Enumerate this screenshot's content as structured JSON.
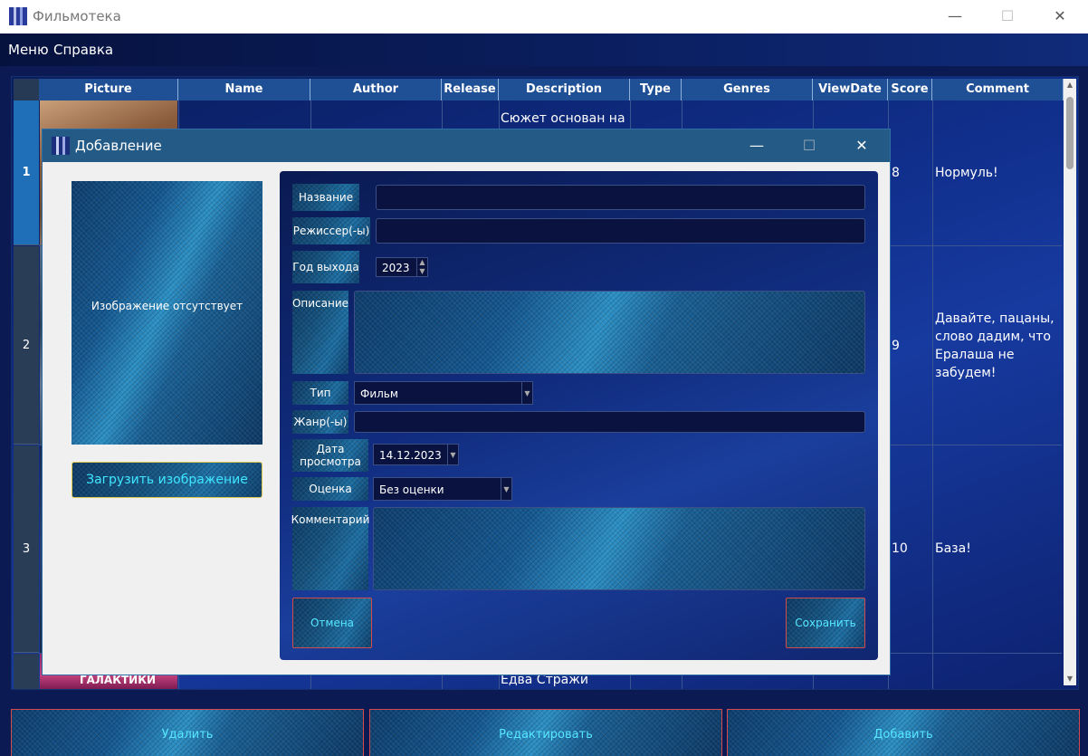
{
  "window": {
    "title": "Фильмотека"
  },
  "menu": [
    "Меню",
    "Справка"
  ],
  "table": {
    "columns": [
      "Picture",
      "Name",
      "Author",
      "Release",
      "Description",
      "Type",
      "Genres",
      "ViewDate",
      "Score",
      "Comment"
    ],
    "rows": [
      {
        "index": "1",
        "description": "Сюжет основан на",
        "score": "8",
        "comment": "Нормуль!"
      },
      {
        "index": "2",
        "description": "",
        "score": "9",
        "comment": "Давайте, пацаны, слово дадим, что Ералаша не забудем!"
      },
      {
        "index": "3",
        "description": "",
        "score": "10",
        "comment": "База!"
      },
      {
        "index": "",
        "description": "Едва Стражи",
        "score": "",
        "comment": ""
      }
    ],
    "poster_caption": "ГАЛАКТИКИ"
  },
  "bottom_buttons": {
    "delete": "Удалить",
    "edit": "Редактировать",
    "add": "Добавить"
  },
  "dialog": {
    "title": "Добавление",
    "image_placeholder": "Изображение отсутствует",
    "load_image_button": "Загрузить изображение",
    "fields": {
      "name_label": "Название",
      "name_value": "",
      "director_label": "Режиссер(-ы)",
      "director_value": "",
      "year_label": "Год выхода",
      "year_value": "2023",
      "description_label": "Описание",
      "type_label": "Тип",
      "type_value": "Фильм",
      "genre_label": "Жанр(-ы)",
      "genre_value": "",
      "viewdate_label": "Дата просмотра",
      "viewdate_value": "14.12.2023",
      "score_label": "Оценка",
      "score_value": "Без оценки",
      "comment_label": "Комментарий"
    },
    "cancel_button": "Отмена",
    "save_button": "Сохранить"
  },
  "colors": {
    "accent_text": "#57e7ff",
    "button_border": "#d44b4b",
    "header_bg": "#1f4f95"
  }
}
